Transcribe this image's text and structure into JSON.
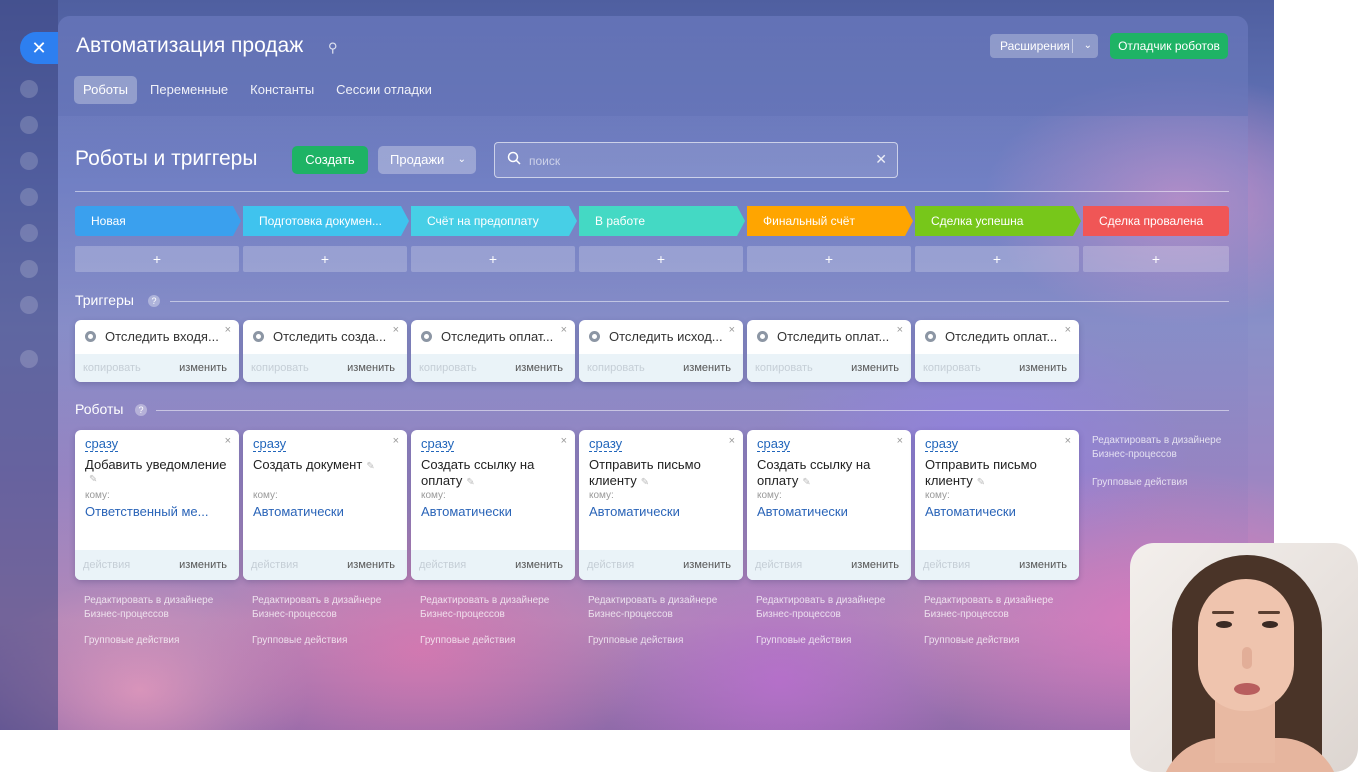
{
  "window": {
    "title": "Автоматизация продаж",
    "extensions_label": "Расширения",
    "debugger_label": "Отладчик роботов"
  },
  "tabs": [
    {
      "label": "Роботы",
      "active": true
    },
    {
      "label": "Переменные",
      "active": false
    },
    {
      "label": "Константы",
      "active": false
    },
    {
      "label": "Сессии отладки",
      "active": false
    }
  ],
  "toolbar": {
    "section_title": "Роботы и триггеры",
    "create_label": "Создать",
    "category_label": "Продажи",
    "search_placeholder": "поиск"
  },
  "stages": [
    {
      "label": "Новая",
      "color": "#3aa0ee"
    },
    {
      "label": "Подготовка докумен...",
      "color": "#3fc3ee"
    },
    {
      "label": "Счёт на предоплату",
      "color": "#47cfe6"
    },
    {
      "label": "В работе",
      "color": "#44d9c4"
    },
    {
      "label": "Финальный счёт",
      "color": "#ffa500"
    },
    {
      "label": "Сделка успешна",
      "color": "#77c71a"
    },
    {
      "label": "Сделка провалена",
      "color": "#f05656"
    }
  ],
  "add_label": "+",
  "triggers": {
    "title": "Триггеры",
    "help": "?",
    "copy_label": "копировать",
    "edit_label": "изменить",
    "items": [
      {
        "name": "Отследить входя..."
      },
      {
        "name": "Отследить созда..."
      },
      {
        "name": "Отследить оплат..."
      },
      {
        "name": "Отследить исход..."
      },
      {
        "name": "Отследить оплат..."
      },
      {
        "name": "Отследить оплат..."
      }
    ]
  },
  "robots": {
    "title": "Роботы",
    "help": "?",
    "when_label": "сразу",
    "to_label": "кому:",
    "actions_label": "действия",
    "edit_label": "изменить",
    "pen_glyph": "✎",
    "items": [
      {
        "name": "Добавить уведомление",
        "to": "Ответственный ме..."
      },
      {
        "name": "Создать документ",
        "to": "Автоматически"
      },
      {
        "name": "Создать ссылку на оплату",
        "to": "Автоматически"
      },
      {
        "name": "Отправить письмо клиенту",
        "to": "Автоматически"
      },
      {
        "name": "Создать ссылку на оплату",
        "to": "Автоматически"
      },
      {
        "name": "Отправить письмо клиенту",
        "to": "Автоматически"
      }
    ]
  },
  "under_links": {
    "designer": "Редактировать в дизайнере Бизнес-процессов",
    "group": "Групповые действия"
  },
  "close_glyph": "✕",
  "pin_glyph": "⚲",
  "clear_glyph": "✕",
  "chevron_glyph": "⌄",
  "x_glyph": "×",
  "colors": {
    "accent_green": "#1eb365",
    "close_blue": "#2d7ff0",
    "link_blue": "#2a64b8"
  }
}
